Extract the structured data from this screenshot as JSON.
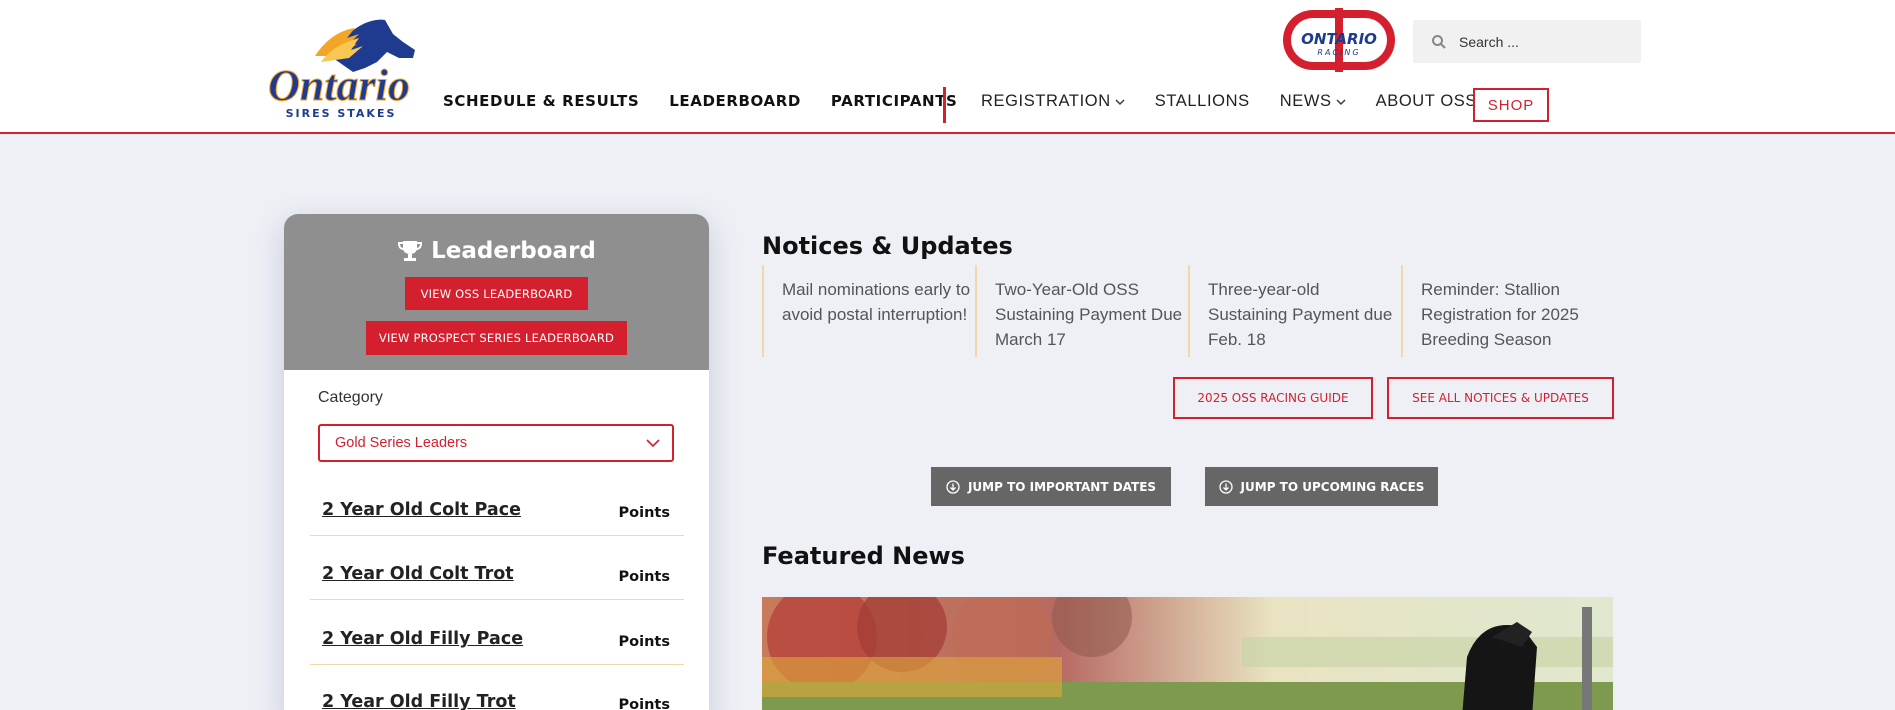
{
  "header": {
    "logo_text": "Ontario",
    "logo_sub": "SIRES STAKES",
    "racing_logo_top": "ONTARIO",
    "racing_logo_bottom": "RACING",
    "search_placeholder": "Search ...",
    "nav_main": [
      "SCHEDULE & RESULTS",
      "LEADERBOARD",
      "PARTICIPANTS"
    ],
    "nav_secondary": [
      {
        "label": "REGISTRATION",
        "dropdown": true
      },
      {
        "label": "STALLIONS",
        "dropdown": false
      },
      {
        "label": "NEWS",
        "dropdown": true
      },
      {
        "label": "ABOUT OSS",
        "dropdown": true
      }
    ],
    "shop_label": "SHOP"
  },
  "leaderboard": {
    "title": "Leaderboard",
    "btn_oss": "VIEW OSS LEADERBOARD",
    "btn_prospect": "VIEW PROSPECT SERIES LEADERBOARD",
    "category_label": "Category",
    "category_selected": "Gold Series Leaders",
    "rows": [
      {
        "title": "2 Year Old Colt Pace",
        "points": "Points"
      },
      {
        "title": "2 Year Old Colt Trot",
        "points": "Points"
      },
      {
        "title": "2 Year Old Filly Pace",
        "points": "Points"
      },
      {
        "title": "2 Year Old Filly Trot",
        "points": "Points"
      }
    ]
  },
  "notices": {
    "title": "Notices & Updates",
    "items": [
      "Mail nominations early to avoid postal interruption!",
      "Two-Year-Old OSS Sustaining Payment Due March 17",
      "Three-year-old Sustaining Payment due Feb. 18",
      "Reminder: Stallion Registration for 2025 Breeding Season"
    ],
    "btn_guide": "2025 OSS RACING GUIDE",
    "btn_all": "SEE ALL NOTICES & UPDATES"
  },
  "jump": {
    "dates": "JUMP TO IMPORTANT DATES",
    "races": "JUMP TO UPCOMING RACES"
  },
  "featured": {
    "title": "Featured News"
  },
  "colors": {
    "accent": "#d41f2f",
    "page_bg": "#eef0f6",
    "card_head": "#8f8f8f",
    "logo_blue": "#1f3b8f",
    "divider": "#f1d8a8"
  }
}
